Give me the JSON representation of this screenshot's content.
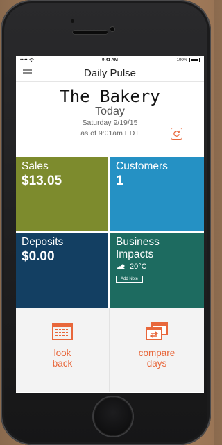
{
  "status_bar": {
    "carrier": "•••••",
    "time": "9:41 AM",
    "battery": "100%"
  },
  "navbar": {
    "title": "Daily Pulse"
  },
  "header": {
    "store_name": "The Bakery",
    "period": "Today",
    "date": "Saturday 9/19/15",
    "as_of": "as of 9:01am EDT"
  },
  "tiles": {
    "sales": {
      "label": "Sales",
      "value": "$13.05"
    },
    "customers": {
      "label": "Customers",
      "value": "1"
    },
    "deposits": {
      "label": "Deposits",
      "value": "$0.00"
    },
    "impacts": {
      "label_line1": "Business",
      "label_line2": "Impacts",
      "weather": "20°C",
      "add_note": "Add Note"
    }
  },
  "actions": {
    "look_back": {
      "line1": "look",
      "line2": "back"
    },
    "compare_days": {
      "line1": "compare",
      "line2": "days"
    }
  },
  "colors": {
    "accent": "#e8673b",
    "sales": "#7d8b2d",
    "customers": "#2591c4",
    "deposits": "#133f62",
    "impacts": "#1d6b60"
  },
  "icons": [
    "menu-icon",
    "wifi-icon",
    "battery-icon",
    "refresh-icon",
    "weather-icon",
    "calendar-icon",
    "compare-icon"
  ]
}
